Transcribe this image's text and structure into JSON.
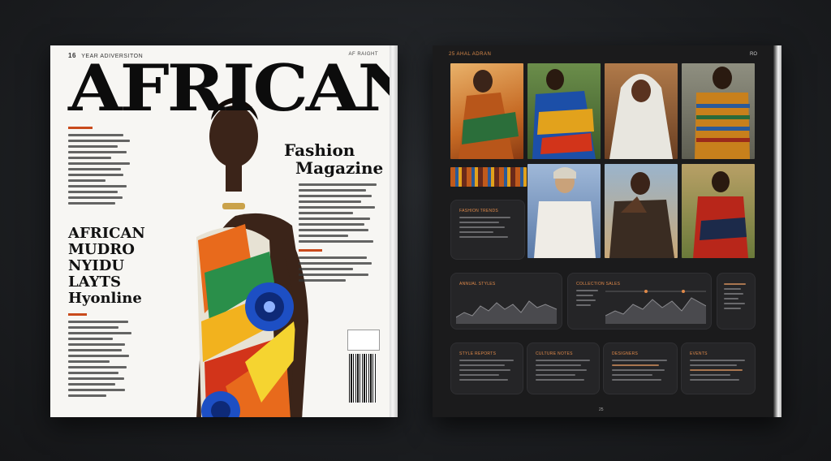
{
  "cover": {
    "issue_number": "16",
    "issue_text": "YEAR ADIVERSITON",
    "issue_right": "AF RAIGHT",
    "masthead": "AFRICAN",
    "subtitle_line1": "Fashion",
    "subtitle_line2": "Magazine",
    "headline_line1": "AFRICAN",
    "headline_line2": "MUDRO",
    "headline_line3": "NYIDU",
    "headline_line4": "LAYTS",
    "headline_line5": "Hyonline"
  },
  "spread": {
    "header_left": "25 AHAL ADRAN",
    "header_right": "RO",
    "page_number": "25",
    "panels": [
      {
        "title": "FASHION TRENDS"
      },
      {
        "title": "ANNUAL STYLES"
      },
      {
        "title": "COLLECTION SALES"
      },
      {
        "title": "STYLE REPORTS"
      },
      {
        "title": "CULTURE NOTES"
      },
      {
        "title": "DESIGNERS"
      },
      {
        "title": "EVENTS"
      }
    ]
  },
  "colors": {
    "accent_orange": "#e08a4a",
    "cover_red": "#c94a1c",
    "spread_bg": "#1b1b1c",
    "cover_bg": "#f7f6f3"
  }
}
